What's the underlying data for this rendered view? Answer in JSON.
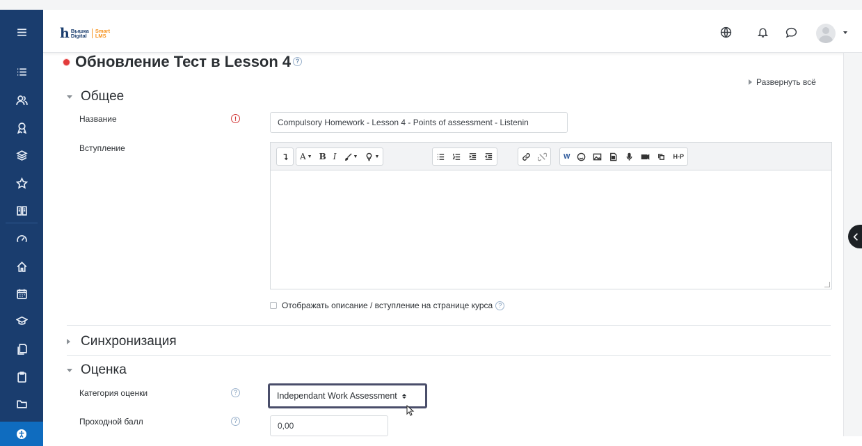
{
  "brand": {
    "mark": "h",
    "line1": "Вышка",
    "line2": "Digital",
    "sub1": "Smart",
    "sub2": "LMS",
    "accent": "#f7931e",
    "primary": "#1a3d6e"
  },
  "sidebar": {
    "items": [
      {
        "icon": "hamburger-icon"
      },
      {
        "icon": "list-icon"
      },
      {
        "icon": "users-icon"
      },
      {
        "icon": "award-icon"
      },
      {
        "icon": "layers-icon"
      },
      {
        "icon": "star-icon"
      },
      {
        "icon": "book-icon"
      },
      {
        "icon": "dashboard-icon"
      },
      {
        "icon": "home-icon"
      },
      {
        "icon": "calendar-icon"
      },
      {
        "icon": "graduation-icon"
      },
      {
        "icon": "files-icon"
      },
      {
        "icon": "clipboard-icon"
      },
      {
        "icon": "folder-icon"
      },
      {
        "icon": "accessibility-icon"
      }
    ]
  },
  "navbar": {
    "icons": [
      "globe-icon",
      "bell-icon",
      "chat-icon",
      "avatar"
    ]
  },
  "page": {
    "title": "Обновление Тест в Lesson 4",
    "help": "?",
    "expand_all": "Развернуть всё"
  },
  "general": {
    "heading": "Общее",
    "name_label": "Название",
    "required_mark": "!",
    "name_value": "Compulsory Homework - Lesson 4 - Points of assessment - Listenin",
    "intro_label": "Вступление",
    "show_description": "Отображать описание / вступление на странице курса",
    "help": "?"
  },
  "toolbar": {
    "buttons": [
      "format",
      "A▾",
      "B",
      "I",
      "brush▾",
      "bulb▾",
      "ul",
      "ol",
      "indent",
      "outdent",
      "link",
      "unlink",
      "W",
      "emoji",
      "image",
      "media",
      "mic",
      "video",
      "copy",
      "H-P"
    ],
    "font_label": "A",
    "bold_label": "B",
    "italic_label": "I",
    "word_label": "W",
    "h5p_label": "H-P"
  },
  "sync": {
    "heading": "Синхронизация"
  },
  "grade": {
    "heading": "Оценка",
    "category_label": "Категория оценки",
    "category_value": "Independant Work Assessment",
    "pass_label": "Проходной балл",
    "pass_value": "0,00",
    "help": "?"
  }
}
